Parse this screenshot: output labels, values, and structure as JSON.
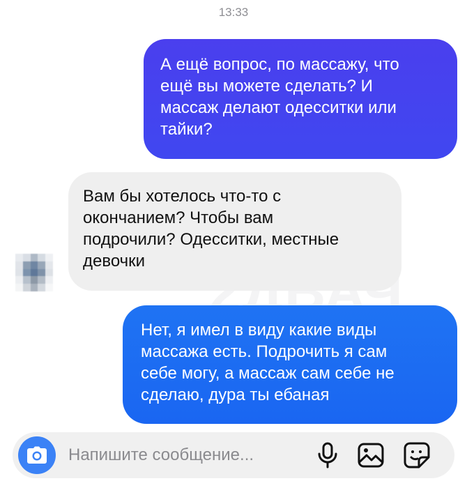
{
  "status": {
    "time": "13:33"
  },
  "watermark": "2ДВАЧ",
  "messages": [
    {
      "direction": "outgoing",
      "text": "А ещё вопрос, по массажу, что\nещё вы можете сделать? И\nмассаж делают одесситки или\nтайки?"
    },
    {
      "direction": "incoming",
      "text": "Вам бы хотелось что-то с\nокончанием? Чтобы вам\nподрочили? Одесситки, местные\nдевочки"
    },
    {
      "direction": "outgoing",
      "text": "Нет, я имел в виду какие виды\nмассажа есть. Подрочить я сам\nсебе могу, а массаж сам себе не\nсделаю, дура ты ебаная"
    }
  ],
  "composer": {
    "placeholder": "Напишите сообщение..."
  },
  "icons": {
    "camera": "camera-icon",
    "mic": "microphone-icon",
    "gallery": "image-gallery-icon",
    "sticker": "sticker-icon"
  },
  "colors": {
    "outgoing_bubble_1": "#4343ef",
    "outgoing_bubble_2": "#1c6cf2",
    "incoming_bubble": "#efefef",
    "camera_button": "#3b82f6"
  }
}
